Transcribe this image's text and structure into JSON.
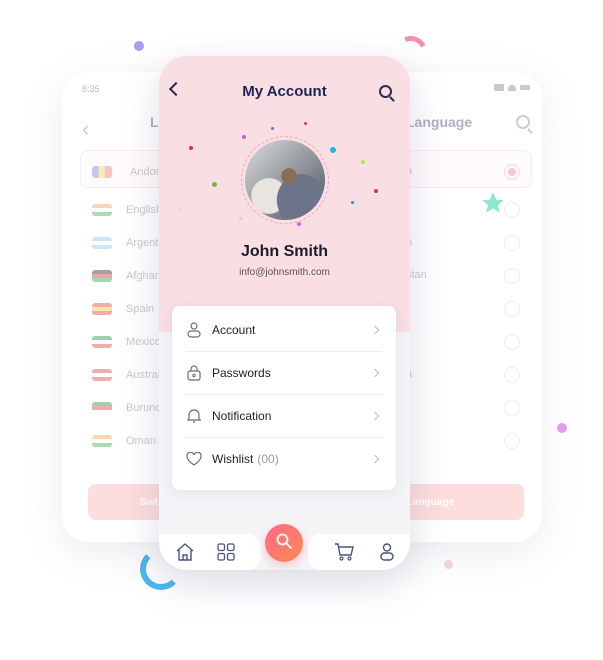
{
  "back_screen": {
    "status_time": "8:35",
    "title_left_fragment": "L",
    "title_right_fragment": "Language",
    "languages": [
      {
        "name": "Andorra",
        "right_fragment": "a",
        "selected": true,
        "flag_colors": [
          "#7a86d8",
          "#f2d05a",
          "#ef7b8c"
        ]
      },
      {
        "name": "English",
        "right_fragment": "",
        "selected": false,
        "flag_colors": [
          "#f5a85a",
          "#ffffff",
          "#4caf50"
        ]
      },
      {
        "name": "Argentina",
        "right_fragment": "a",
        "selected": false,
        "flag_colors": [
          "#8ec8f0",
          "#ffffff",
          "#8ec8f0"
        ]
      },
      {
        "name": "Afghanistan",
        "right_fragment": "stan",
        "selected": false,
        "flag_colors": [
          "#333333",
          "#d23a3a",
          "#3ea84a"
        ]
      },
      {
        "name": "Spain",
        "right_fragment": "",
        "selected": false,
        "flag_colors": [
          "#e34848",
          "#f7c948",
          "#e34848"
        ]
      },
      {
        "name": "Mexico",
        "right_fragment": "",
        "selected": false,
        "flag_colors": [
          "#2f9a4c",
          "#ffffff",
          "#e34848"
        ]
      },
      {
        "name": "Australia",
        "right_fragment": "a",
        "selected": false,
        "flag_colors": [
          "#e34848",
          "#ffffff",
          "#e34848"
        ]
      },
      {
        "name": "Burundi",
        "right_fragment": "",
        "selected": false,
        "flag_colors": [
          "#2f9a4c",
          "#e34848",
          "#ffffff"
        ]
      },
      {
        "name": "Oman",
        "right_fragment": "",
        "selected": false,
        "flag_colors": [
          "#f5a85a",
          "#ffffff",
          "#4caf50"
        ]
      }
    ],
    "switch_button_left": "Swt",
    "switch_button_right": "tch Language"
  },
  "front_screen": {
    "title": "My Account",
    "user_name": "John Smith",
    "user_email": "info@johnsmith.com",
    "menu": [
      {
        "label": "Account",
        "icon": "user-icon",
        "count": ""
      },
      {
        "label": "Passwords",
        "icon": "lock-icon",
        "count": ""
      },
      {
        "label": "Notification",
        "icon": "bell-icon",
        "count": ""
      },
      {
        "label": "Wishlist",
        "icon": "heart-icon",
        "count": "(00)"
      }
    ],
    "bottom_nav": [
      "home-icon",
      "grid-icon",
      "search-icon",
      "cart-icon",
      "profile-icon"
    ]
  },
  "colors": {
    "header_bg": "#f9dfe3",
    "title": "#1f2356",
    "fab_gradient": [
      "#ff6a8a",
      "#ff8a50"
    ],
    "switch_button": "#fbb6b6"
  }
}
